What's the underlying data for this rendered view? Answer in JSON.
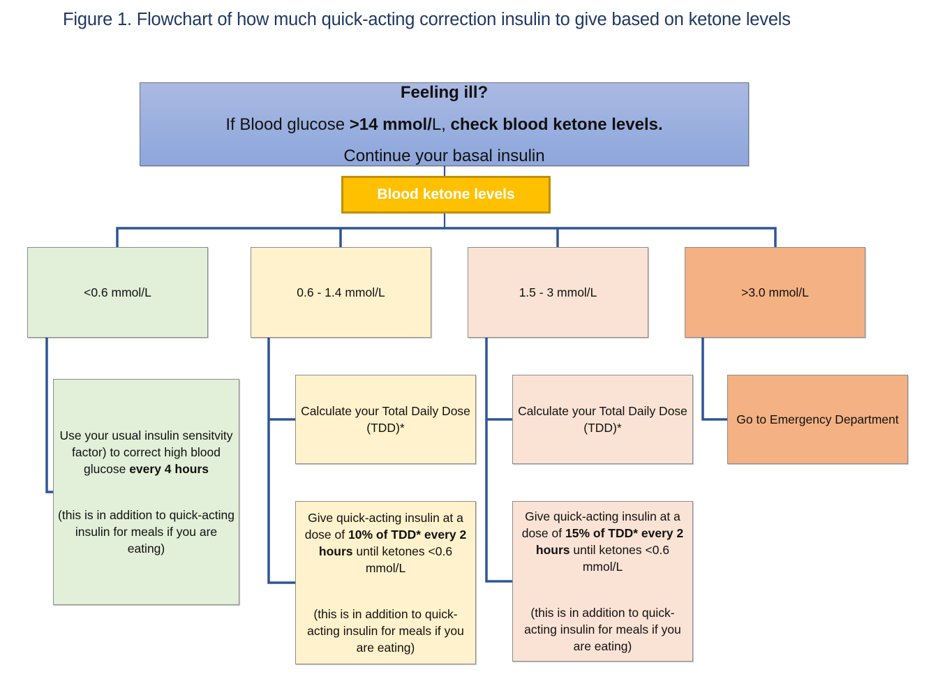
{
  "figure": {
    "title": "Figure 1. Flowchart of how much quick-acting correction insulin to give based on ketone levels"
  },
  "top_box": {
    "heading": "Feeling ill?",
    "line2_pre": "If Blood glucose ",
    "line2_bold1": ">14 mmol/",
    "line2_mid": "L, ",
    "line2_bold2": "check blood ketone levels.",
    "line3": "Continue your basal insulin",
    "color": "#a4b4e0"
  },
  "ketone_box": {
    "label": "Blood ketone levels",
    "color": "#ffc000",
    "border_color": "#bf9000"
  },
  "connector_color": "#2f5597",
  "levels": [
    {
      "label": "<0.6 mmol/L",
      "color": "#e2efd9",
      "actions": [
        {
          "text_pre": "Use your usual insulin sensitvity factor) to correct high blood glucose ",
          "text_bold": "every 4 hours",
          "note": "(this is in addition to quick-acting insulin for meals if you are eating)"
        }
      ]
    },
    {
      "label": "0.6 - 1.4 mmol/L",
      "color": "#fff2cc",
      "actions": [
        {
          "text": "Calculate your Total Daily Dose (TDD)*"
        },
        {
          "text_pre": "Give quick-acting insulin at a dose of ",
          "text_bold1": "10% of TDD*",
          "text_bold2": "every 2 hours",
          "text_post": " until ketones <0.6 mmol/L",
          "note": "(this is in addition to quick-acting insulin for meals if you are eating)"
        }
      ]
    },
    {
      "label": "1.5 - 3 mmol/L",
      "color": "#fae3d5",
      "actions": [
        {
          "text": "Calculate your Total Daily Dose (TDD)*"
        },
        {
          "text_pre": "Give quick-acting insulin at a dose of ",
          "text_bold1": "15% of TDD*",
          "text_bold2": "every 2 hours",
          "text_post": " until ketones <0.6 mmol/L",
          "note": "(this is in addition to quick-acting insulin for meals if you are eating)"
        }
      ]
    },
    {
      "label": ">3.0 mmol/L",
      "color": "#f4b183",
      "actions": [
        {
          "text": "Go to Emergency Department"
        }
      ]
    }
  ]
}
